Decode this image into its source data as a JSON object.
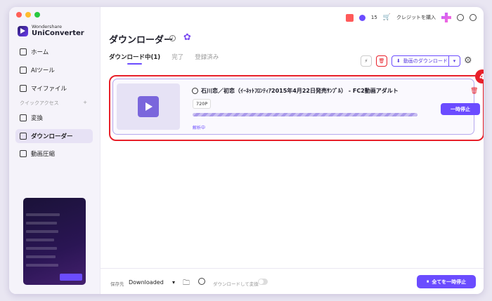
{
  "app": {
    "brand_top": "Wondershare",
    "brand_name": "UniConverter"
  },
  "topbar": {
    "credits": "15",
    "buy_credits": "クレジットを購入"
  },
  "sidebar": {
    "items": [
      {
        "label": "ホーム"
      },
      {
        "label": "AIツール"
      },
      {
        "label": "マイファイル"
      },
      {
        "label": "変換"
      },
      {
        "label": "ダウンローダー"
      },
      {
        "label": "動画圧縮"
      }
    ],
    "quick_access": "クイックアクセス",
    "quick_add": "+"
  },
  "header": {
    "title": "ダウンローダー"
  },
  "tabs": [
    {
      "label": "ダウンロード中(1)"
    },
    {
      "label": "完了"
    },
    {
      "label": "登録済み"
    }
  ],
  "toolbar": {
    "download_video": "動画のダウンロード"
  },
  "annotation": {
    "number": "4"
  },
  "task": {
    "title": "石川恋／初恋（ｲｰﾈｯﾄﾌﾛﾝﾃｨｱ2015年4月22日発売ｻﾝﾌﾟﾙ） - FC2動画アダルト",
    "quality": "720P",
    "progress": 0.0,
    "status": "解析中",
    "pause_label": "一時停止"
  },
  "footer": {
    "save_to_label": "保存先",
    "save_to_value": "Downloaded",
    "convert_label": "ダウンロードして変換",
    "pause_all": "全てを一時停止"
  },
  "colors": {
    "accent": "#6b4cff",
    "highlight": "#e8202a"
  }
}
